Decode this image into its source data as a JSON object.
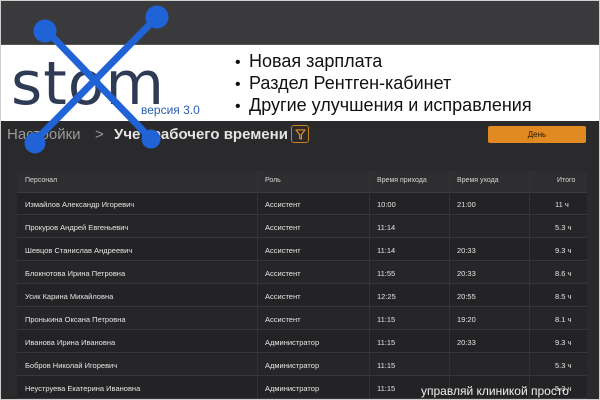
{
  "logo": {
    "wordmark": "stom",
    "version": "версия 3.0"
  },
  "features": [
    "Новая зарплата",
    "Раздел Рентген-кабинет",
    "Другие улучшения и исправления"
  ],
  "breadcrumb": {
    "settings": "Настройки",
    "separator": ">",
    "current": "Учет рабочего времени"
  },
  "toolbar": {
    "filter_icon": "filter-icon",
    "day_label": "День"
  },
  "table": {
    "headers": {
      "name": "Персонал",
      "role": "Роль",
      "arrival": "Время прихода",
      "departure": "Время ухода",
      "total": "Итого"
    },
    "rows": [
      {
        "name": "Измайлов Александр Игоревич",
        "role": "Ассистент",
        "arrival": "10:00",
        "departure": "21:00",
        "total": "11 ч"
      },
      {
        "name": "Прокуров Андрей Евгеньевич",
        "role": "Ассистент",
        "arrival": "11:14",
        "departure": "",
        "total": "5.3 ч"
      },
      {
        "name": "Шевцов Станислав Андреевич",
        "role": "Ассистент",
        "arrival": "11:14",
        "departure": "20:33",
        "total": "9.3 ч"
      },
      {
        "name": "Блокнотова Ирина Петровна",
        "role": "Ассистент",
        "arrival": "11:55",
        "departure": "20:33",
        "total": "8.6 ч"
      },
      {
        "name": "Усик Карина Михайловна",
        "role": "Ассистент",
        "arrival": "12:25",
        "departure": "20:55",
        "total": "8.5 ч"
      },
      {
        "name": "Пронькина Оксана Петровна",
        "role": "Ассистент",
        "arrival": "11:15",
        "departure": "19:20",
        "total": "8.1 ч"
      },
      {
        "name": "Иванова Ирина Ивановна",
        "role": "Администратор",
        "arrival": "11:15",
        "departure": "20:33",
        "total": "9.3 ч"
      },
      {
        "name": "Бобров Николай Игоревич",
        "role": "Администратор",
        "arrival": "11:15",
        "departure": "",
        "total": "5.3 ч"
      },
      {
        "name": "Неуструева Екатерина Ивановна",
        "role": "Администратор",
        "arrival": "11:15",
        "departure": "",
        "total": "5.3 ч"
      }
    ]
  },
  "tagline": "управляй клиникой просто",
  "colors": {
    "accent": "#e28a22",
    "logo_blue": "#1f63d6",
    "logo_text": "#2f3a55",
    "background": "#2a2a2c"
  }
}
